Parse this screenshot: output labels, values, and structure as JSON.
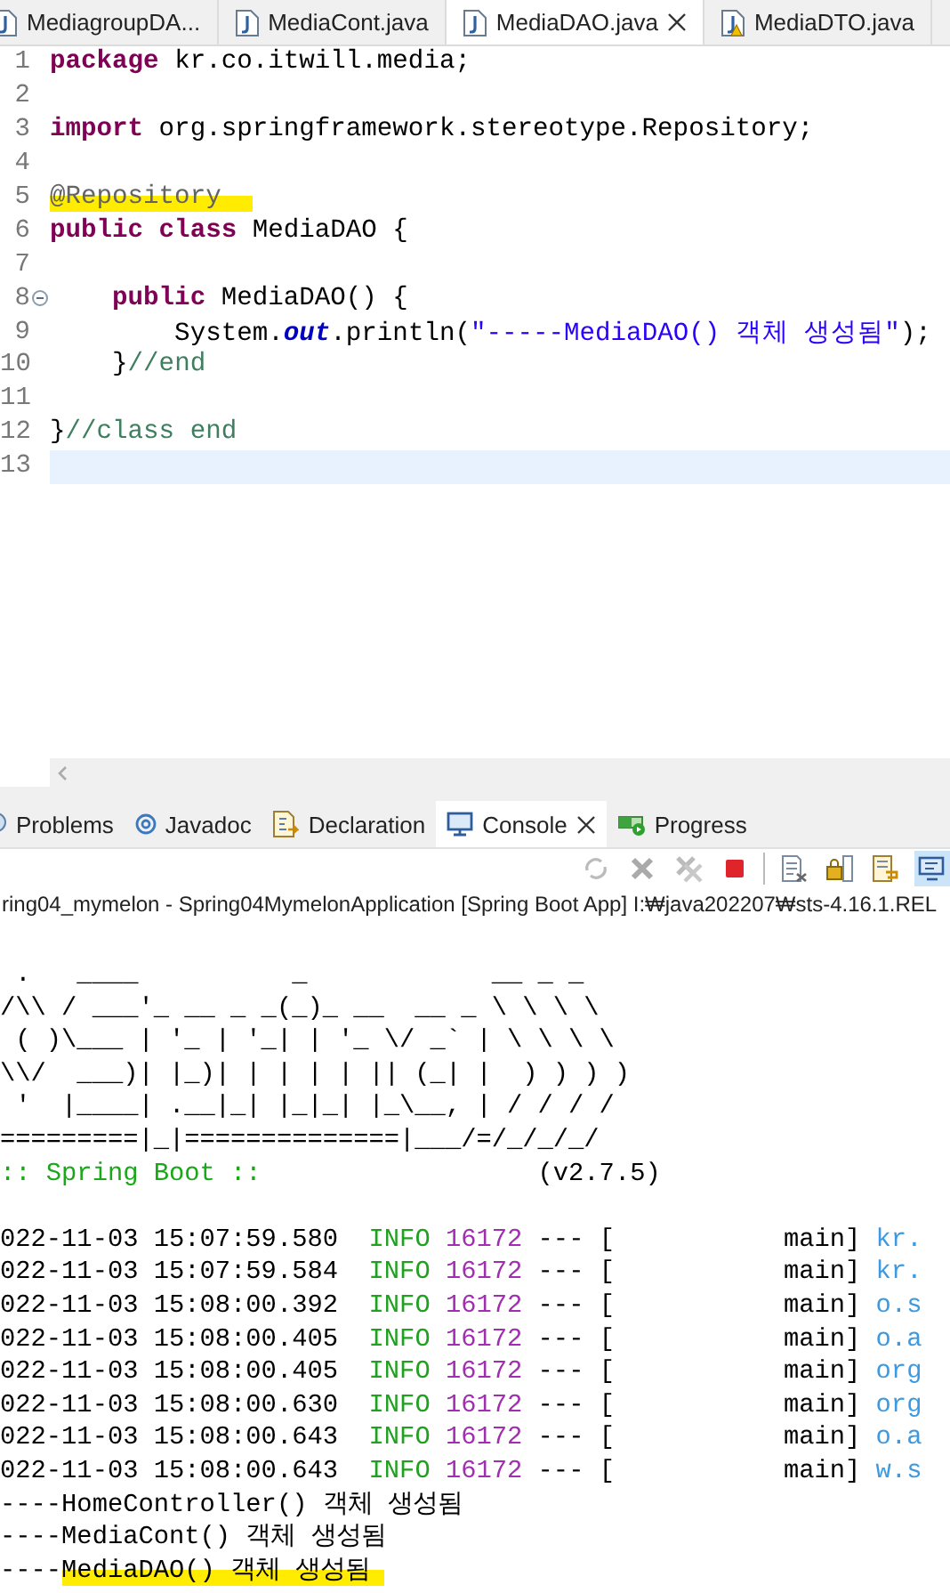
{
  "editor_tabs": [
    {
      "label": "MediagroupDA...",
      "selected": false,
      "warning": false
    },
    {
      "label": "MediaCont.java",
      "selected": false,
      "warning": false
    },
    {
      "label": "MediaDAO.java",
      "selected": true,
      "warning": false
    },
    {
      "label": "MediaDTO.java",
      "selected": false,
      "warning": true
    }
  ],
  "code_lines": [
    {
      "number": "1",
      "current": false,
      "foldable": false,
      "tokens": [
        {
          "kind": "keyword",
          "text": "package",
          "highlighted": false
        },
        {
          "kind": "plain",
          "text": " kr.co.itwill.media;",
          "highlighted": false
        }
      ]
    },
    {
      "number": "2",
      "current": false,
      "foldable": false
    },
    {
      "number": "3",
      "current": false,
      "foldable": false,
      "tokens": [
        {
          "kind": "keyword",
          "text": "import",
          "highlighted": false
        },
        {
          "kind": "plain",
          "text": " org.springframework.stereotype.Repository;",
          "highlighted": false
        }
      ]
    },
    {
      "number": "4",
      "current": false,
      "foldable": false
    },
    {
      "number": "5",
      "current": false,
      "foldable": false,
      "tokens": [
        {
          "kind": "annotation",
          "text": "@Repository",
          "highlighted": true
        }
      ]
    },
    {
      "number": "6",
      "current": false,
      "foldable": false,
      "tokens": [
        {
          "kind": "keyword",
          "text": "public class",
          "highlighted": false
        },
        {
          "kind": "plain",
          "text": " MediaDAO {",
          "highlighted": false
        }
      ]
    },
    {
      "number": "7",
      "current": false,
      "foldable": false
    },
    {
      "number": "8",
      "current": false,
      "foldable": true,
      "tokens": [
        {
          "kind": "keyword",
          "text": "    public",
          "highlighted": false
        },
        {
          "kind": "plain",
          "text": " MediaDAO() {",
          "highlighted": false
        }
      ]
    },
    {
      "number": "9",
      "current": false,
      "foldable": false,
      "tokens": [
        {
          "kind": "plain",
          "text": "        System.",
          "highlighted": false
        },
        {
          "kind": "field",
          "text": "out",
          "highlighted": false
        },
        {
          "kind": "plain",
          "text": ".println(",
          "highlighted": false
        },
        {
          "kind": "string",
          "text": "\"-----MediaDAO() 객체 생성됨\"",
          "highlighted": false
        },
        {
          "kind": "plain",
          "text": ");",
          "highlighted": false
        }
      ]
    },
    {
      "number": "10",
      "current": false,
      "foldable": false,
      "tokens": [
        {
          "kind": "plain",
          "text": "    }",
          "highlighted": false
        },
        {
          "kind": "comment",
          "text": "//end",
          "highlighted": false
        }
      ]
    },
    {
      "number": "11",
      "current": false,
      "foldable": false
    },
    {
      "number": "12",
      "current": false,
      "foldable": false,
      "tokens": [
        {
          "kind": "plain",
          "text": "}",
          "highlighted": false
        },
        {
          "kind": "comment",
          "text": "//class end",
          "highlighted": false
        }
      ]
    },
    {
      "number": "13",
      "current": true,
      "foldable": false
    }
  ],
  "view_tabs": [
    {
      "label": "Problems",
      "selected": false,
      "closable": false
    },
    {
      "label": "Javadoc",
      "selected": false,
      "closable": false
    },
    {
      "label": "Declaration",
      "selected": false,
      "closable": false
    },
    {
      "label": "Console",
      "selected": true,
      "closable": true
    },
    {
      "label": "Progress",
      "selected": false,
      "closable": false
    }
  ],
  "console": {
    "title": "ring04_mymelon - Spring04MymelonApplication [Spring Boot App] I:₩java202207₩sts-4.16.1.REL",
    "banner": [
      " .   ____          _            __ _ _",
      "/\\\\ / ___'_ __ _ _(_)_ __  __ _ \\ \\ \\ \\",
      " ( )\\___ | '_ | '_| | '_ \\/ _` | \\ \\ \\ \\",
      "\\\\/  ___)| |_)| | | | | || (_| |  ) ) ) )",
      " '  |____| .__|_| |_|_| |_\\__, | / / / /",
      "=========|_|==============|___/=/_/_/_/"
    ],
    "boot_label": ":: Spring Boot ::",
    "version": "(v2.7.5)",
    "logs": [
      {
        "timestamp": "022-11-03 15:07:59.580",
        "level": "INFO",
        "pid": "16172",
        "thread": "--- [           main]",
        "logger": "kr."
      },
      {
        "timestamp": "022-11-03 15:07:59.584",
        "level": "INFO",
        "pid": "16172",
        "thread": "--- [           main]",
        "logger": "kr."
      },
      {
        "timestamp": "022-11-03 15:08:00.392",
        "level": "INFO",
        "pid": "16172",
        "thread": "--- [           main]",
        "logger": "o.s"
      },
      {
        "timestamp": "022-11-03 15:08:00.405",
        "level": "INFO",
        "pid": "16172",
        "thread": "--- [           main]",
        "logger": "o.a"
      },
      {
        "timestamp": "022-11-03 15:08:00.405",
        "level": "INFO",
        "pid": "16172",
        "thread": "--- [           main]",
        "logger": "org"
      },
      {
        "timestamp": "022-11-03 15:08:00.630",
        "level": "INFO",
        "pid": "16172",
        "thread": "--- [           main]",
        "logger": "org"
      },
      {
        "timestamp": "022-11-03 15:08:00.643",
        "level": "INFO",
        "pid": "16172",
        "thread": "--- [           main]",
        "logger": "o.a"
      },
      {
        "timestamp": "022-11-03 15:08:00.643",
        "level": "INFO",
        "pid": "16172",
        "thread": "--- [           main]",
        "logger": "w.s"
      }
    ],
    "messages": [
      {
        "prefix": "----",
        "text": "HomeController() 객체 생성됨",
        "highlighted": false
      },
      {
        "prefix": "----",
        "text": "MediaCont() 객체 생성됨",
        "highlighted": false
      },
      {
        "prefix": "----",
        "text": "MediaDAO() 객체 생성됨",
        "highlighted": true
      }
    ]
  }
}
